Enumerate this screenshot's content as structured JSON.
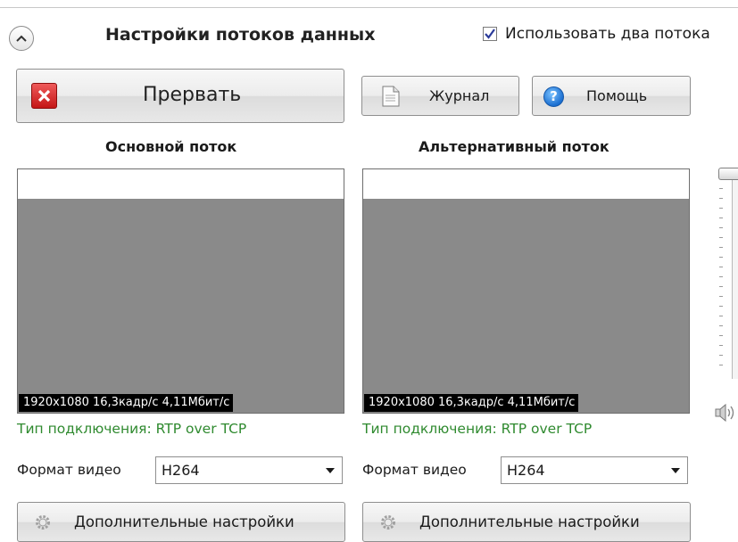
{
  "header": {
    "title": "Настройки потоков данных",
    "dual_stream_checkbox": {
      "label": "Использовать два потока",
      "checked": true
    }
  },
  "toolbar": {
    "abort_label": "Прервать",
    "log_label": "Журнал",
    "help_label": "Помощь",
    "help_icon_glyph": "?"
  },
  "streams": [
    {
      "title": "Основной поток",
      "info": "1920x1080  16,3кадр/с  4,11Мбит/с",
      "connection": "Тип подключения:  RTP over TCP",
      "format_label": "Формат видео",
      "format_value": "H264",
      "advanced_label": "Дополнительные настройки"
    },
    {
      "title": "Альтернативный поток",
      "info": "1920x1080  16,3кадр/с  4,11Мбит/с",
      "connection": "Тип подключения:  RTP over TCP",
      "format_label": "Формат видео",
      "format_value": "H264",
      "advanced_label": "Дополнительные настройки"
    }
  ],
  "colors": {
    "connection_text": "#2f8a2f",
    "abort_icon": "#d42020",
    "help_icon": "#1b6fd1"
  },
  "icons": {
    "collapse": "chevron-up-icon",
    "abort": "close-icon",
    "log": "document-icon",
    "help": "help-icon",
    "advanced": "gear-icon",
    "volume": "speaker-icon"
  }
}
